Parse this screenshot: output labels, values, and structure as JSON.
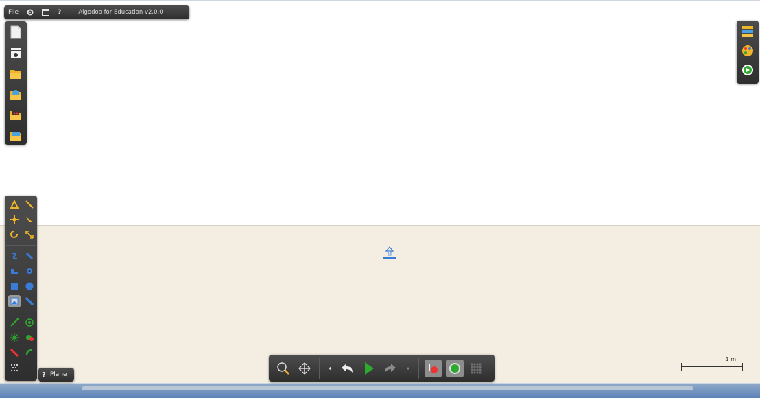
{
  "menu": {
    "file_label": "File",
    "help_label": "?",
    "app_title": "Algodoo for Education v2.0.0"
  },
  "plane_box": {
    "help_label": "?",
    "plane_label": "Plane"
  },
  "scale_bar": {
    "label": "1 m"
  },
  "file_toolbar": {
    "icons": [
      "new-scene-icon",
      "scene-properties-icon",
      "open-folder-icon",
      "open-sample-folder-icon",
      "open-phunlet-folder-icon",
      "save-folder-icon"
    ]
  },
  "tool_palette": {
    "icons": [
      "sketch-tool-icon",
      "cut-tool-icon",
      "move-tool-icon",
      "drag-tool-icon",
      "rotate-tool-icon",
      "scale-tool-icon",
      "spring-tool-icon",
      "chain-tool-icon",
      "plane-tool-icon",
      "gear-tool-icon",
      "box-tool-icon",
      "circle-tool-icon",
      "polygon-tool-icon",
      "brush-tool-icon",
      "fixate-tool-icon",
      "hinge-tool-icon",
      "axle-tool-icon",
      "tracer-tool-icon",
      "laser-tool-icon",
      "thruster-tool-icon",
      "fluid-tool-icon"
    ]
  },
  "bottom_toolbar": {
    "icons": [
      "zoom-icon",
      "pan-icon",
      "undo-small-icon",
      "undo-icon",
      "play-icon",
      "redo-icon",
      "redo-small-icon",
      "gravity-toggle-icon",
      "air-friction-toggle-icon",
      "grid-toggle-icon"
    ]
  },
  "right_toolbar": {
    "icons": [
      "layers-icon",
      "palette-icon",
      "scene-zoom-icon"
    ]
  },
  "colors": {
    "sky": "#ffffff",
    "ground": "#f3eee1",
    "panel": "#3a3a3a",
    "accent_blue": "#3a7bd5",
    "play_green": "#2ea82e"
  }
}
